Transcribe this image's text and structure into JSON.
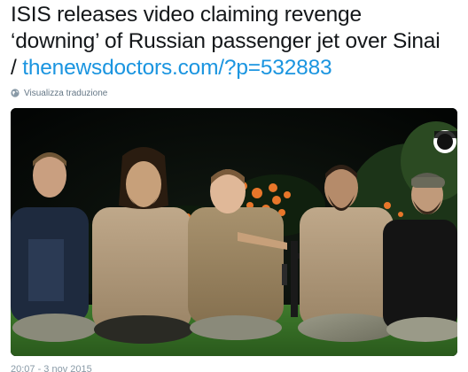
{
  "tweet": {
    "text_line1": "ISIS releases video claiming revenge",
    "text_line2": "‘downing’ of Russian passenger jet over Sinai",
    "text_prefix": "/ ",
    "link": "thenewsdoctors.com/?p=532883"
  },
  "translate": {
    "icon": "globe-icon",
    "label": "Visualizza traduzione"
  },
  "media": {
    "type": "photo",
    "logo_text": "ﻻ إله إلا الله"
  },
  "timestamp": "20:07 - 3 nov 2015",
  "colors": {
    "link": "#1b95e0",
    "text": "#14171a",
    "muted": "#657786"
  }
}
